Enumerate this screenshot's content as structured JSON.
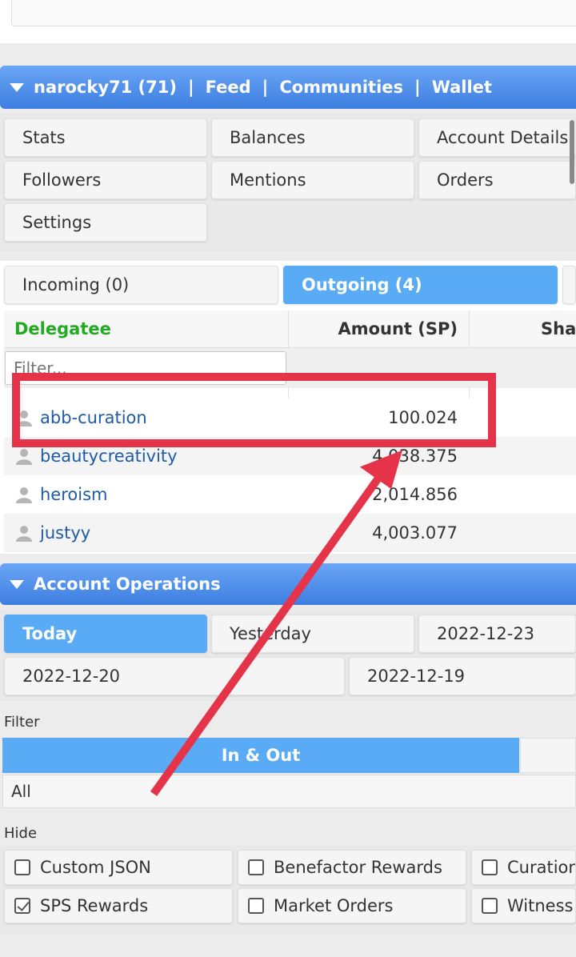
{
  "nav": {
    "username": "narocky71 (71)",
    "sep": "|",
    "feed": "Feed",
    "communities": "Communities",
    "wallet": "Wallet"
  },
  "account_tabs": [
    "Stats",
    "Balances",
    "Account Details",
    "Followers",
    "Mentions",
    "Orders",
    "Settings"
  ],
  "delegation_tabs": {
    "incoming": "Incoming (0)",
    "outgoing": "Outgoing (4)"
  },
  "table": {
    "headers": {
      "delegatee": "Delegatee",
      "amount": "Amount (SP)",
      "share": "Shar"
    },
    "filter_placeholder": "Filter...",
    "rows": [
      {
        "name": "abb-curation",
        "amount": "100.024"
      },
      {
        "name": "beautycreativity",
        "amount": "4,038.375"
      },
      {
        "name": "heroism",
        "amount": "2,014.856"
      },
      {
        "name": "justyy",
        "amount": "4,003.077"
      }
    ]
  },
  "operations": {
    "title": "Account Operations",
    "dates": [
      "Today",
      "Yesterday",
      "2022-12-23",
      "2022-12-20",
      "2022-12-19"
    ],
    "filter_label": "Filter",
    "direction": "In & Out",
    "type_select": "All",
    "hide_label": "Hide",
    "hide_options": [
      {
        "label": "Custom JSON",
        "checked": false
      },
      {
        "label": "Benefactor Rewards",
        "checked": false
      },
      {
        "label": "Curation",
        "checked": false
      },
      {
        "label": "SPS Rewards",
        "checked": true
      },
      {
        "label": "Market Orders",
        "checked": false
      },
      {
        "label": "Witness",
        "checked": false
      }
    ]
  },
  "colors": {
    "header_blue": "#3d7ee0",
    "active_tab": "#5aabf5",
    "link_blue": "#1f5aa6",
    "delegatee_green": "#22aa22",
    "annotation_red": "#e5334a"
  }
}
